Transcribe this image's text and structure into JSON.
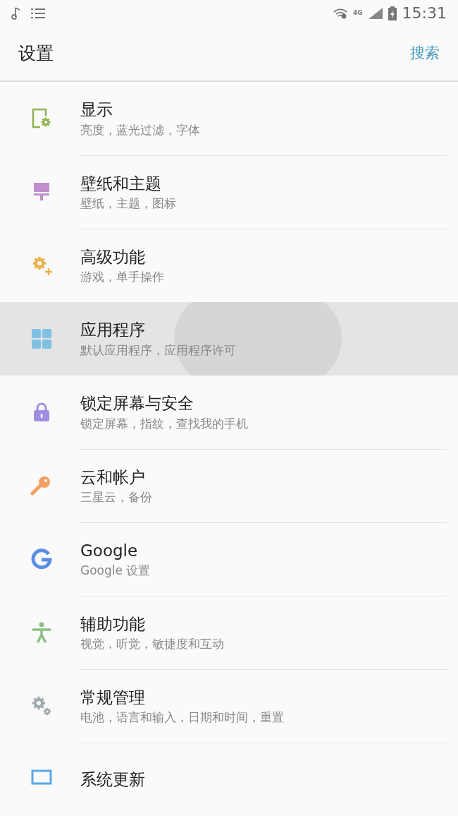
{
  "status_bar": {
    "time": "15:31",
    "network": "4G"
  },
  "header": {
    "title": "设置",
    "action": "搜索"
  },
  "items": [
    {
      "title": "显示",
      "subtitle": "亮度，蓝光过滤，字体",
      "pressed": false
    },
    {
      "title": "壁纸和主题",
      "subtitle": "壁纸，主题，图标",
      "pressed": false
    },
    {
      "title": "高级功能",
      "subtitle": "游戏，单手操作",
      "pressed": false
    },
    {
      "title": "应用程序",
      "subtitle": "默认应用程序，应用程序许可",
      "pressed": true
    },
    {
      "title": "锁定屏幕与安全",
      "subtitle": "锁定屏幕，指纹，查找我的手机",
      "pressed": false
    },
    {
      "title": "云和帐户",
      "subtitle": "三星云，备份",
      "pressed": false
    },
    {
      "title": "Google",
      "subtitle": "Google 设置",
      "pressed": false
    },
    {
      "title": "辅助功能",
      "subtitle": "视觉，听觉，敏捷度和互动",
      "pressed": false
    },
    {
      "title": "常规管理",
      "subtitle": "电池，语言和输入，日期和时间，重置",
      "pressed": false
    },
    {
      "title": "系统更新",
      "pressed": false
    }
  ]
}
